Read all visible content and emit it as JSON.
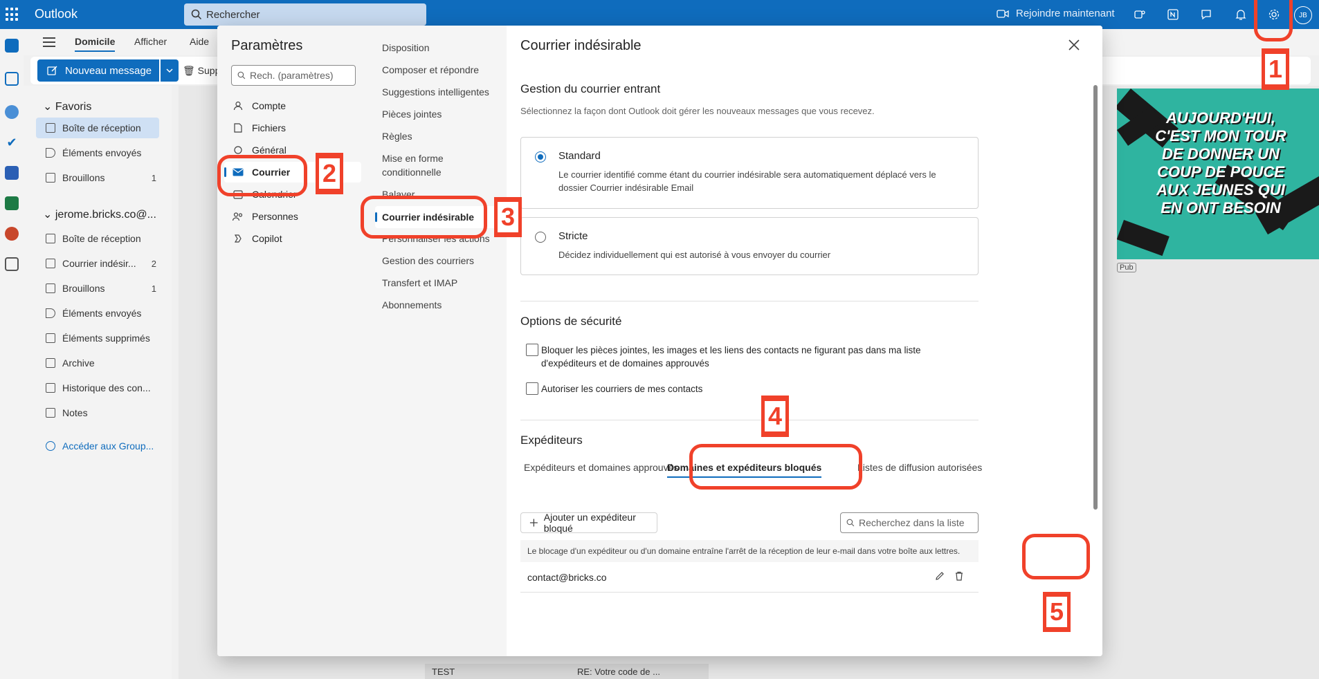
{
  "topbar": {
    "app_name": "Outlook",
    "search_placeholder": "Rechercher",
    "join_label": "Rejoindre maintenant",
    "avatar_initials": "JB"
  },
  "ribbon": {
    "tabs": [
      "Domicile",
      "Afficher",
      "Aide"
    ],
    "new_message": "Nouveau message",
    "delete_partial": "Supp"
  },
  "folders": {
    "favorites_header": "Favoris",
    "favorites": [
      {
        "label": "Boîte de réception",
        "count": ""
      },
      {
        "label": "Éléments envoyés",
        "count": ""
      },
      {
        "label": "Brouillons",
        "count": "1"
      }
    ],
    "account_header": "jerome.bricks.co@...",
    "account": [
      {
        "label": "Boîte de réception",
        "count": ""
      },
      {
        "label": "Courrier indésir...",
        "count": "2"
      },
      {
        "label": "Brouillons",
        "count": "1"
      },
      {
        "label": "Éléments envoyés",
        "count": ""
      },
      {
        "label": "Éléments supprimés",
        "count": ""
      },
      {
        "label": "Archive",
        "count": ""
      },
      {
        "label": "Historique des con...",
        "count": ""
      },
      {
        "label": "Notes",
        "count": ""
      }
    ],
    "groups_link": "Accéder aux Group..."
  },
  "settings": {
    "title": "Paramètres",
    "search_placeholder": "Rech. (paramètres)",
    "categories": [
      "Compte",
      "Fichiers",
      "Général",
      "Courrier",
      "Calendrier",
      "Personnes",
      "Copilot"
    ],
    "subcategories": [
      "Disposition",
      "Composer et répondre",
      "Suggestions intelligentes",
      "Pièces jointes",
      "Règles",
      "Mise en forme conditionnelle",
      "Balayer",
      "Courrier indésirable",
      "Personnaliser les actions",
      "Gestion des courriers",
      "Transfert et IMAP",
      "Abonnements"
    ]
  },
  "junk": {
    "title": "Courrier indésirable",
    "incoming_header": "Gestion du courrier entrant",
    "incoming_desc": "Sélectionnez la façon dont Outlook doit gérer les nouveaux messages que vous recevez.",
    "standard_title": "Standard",
    "standard_desc": "Le courrier identifié comme étant du courrier indésirable sera automatiquement déplacé vers le dossier Courrier indésirable Email",
    "strict_title": "Stricte",
    "strict_desc": "Décidez individuellement qui est autorisé à vous envoyer du courrier",
    "security_header": "Options de sécurité",
    "security_opt1": "Bloquer les pièces jointes, les images et les liens des contacts ne figurant pas dans ma liste d'expéditeurs et de domaines approuvés",
    "security_opt2": "Autoriser les courriers de mes contacts",
    "senders_header": "Expéditeurs",
    "tabs": [
      "Expéditeurs et domaines approuvés",
      "Domaines et expéditeurs bloqués",
      "Listes de diffusion autorisées"
    ],
    "add_blocked": "Ajouter un expéditeur bloqué",
    "list_search_placeholder": "Recherchez dans la liste",
    "info": "Le blocage d'un expéditeur ou d'un domaine entraîne l'arrêt de la réception de leur e-mail dans votre boîte aux lettres.",
    "entries": [
      "contact@bricks.co"
    ]
  },
  "annotations": [
    "1",
    "2",
    "3",
    "4",
    "5"
  ],
  "ad": {
    "text": "AUJOURD'HUI, C'EST MON TOUR DE DONNER UN COUP DE POUCE AUX JEUNES QUI EN ONT BESOIN",
    "pub_label": "Pub"
  },
  "bottom": {
    "item1": "TEST",
    "item2": "RE: Votre code de ..."
  },
  "colors": {
    "brand": "#0f6cbd",
    "annotation": "#f0412a",
    "ad_bg": "#2fb4a0"
  }
}
